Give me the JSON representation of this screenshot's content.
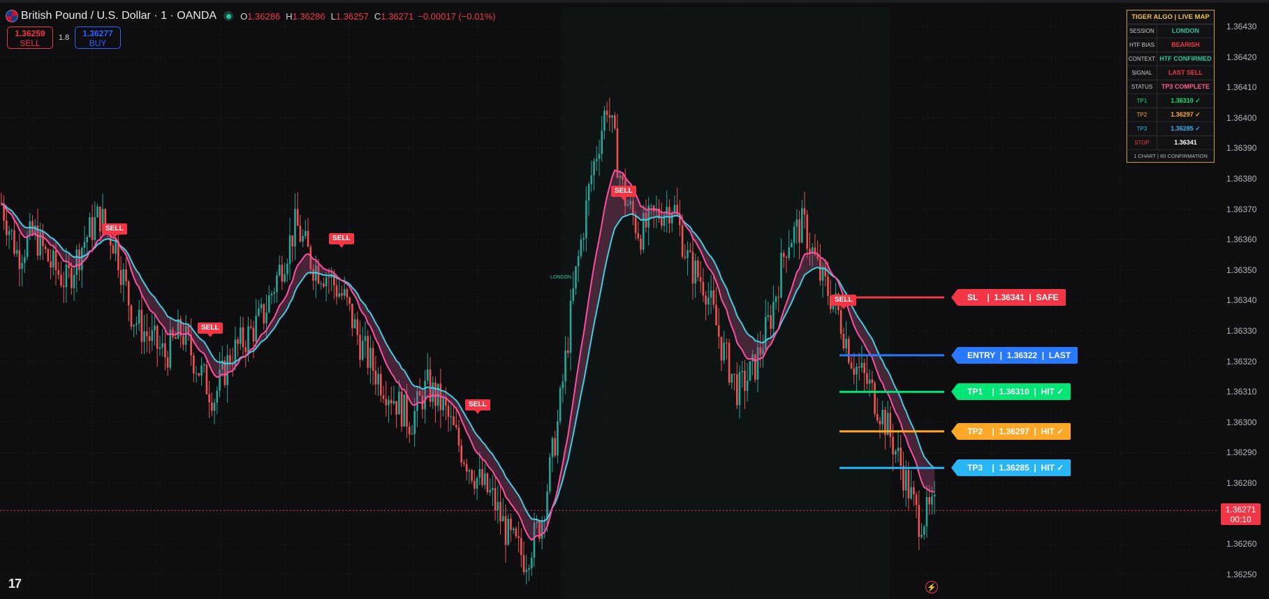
{
  "header": {
    "title": "British Pound / U.S. Dollar · 1 · OANDA",
    "o_label": "O",
    "o_value": "1.36286",
    "h_label": "H",
    "h_value": "1.36286",
    "l_label": "L",
    "l_value": "1.36257",
    "c_label": "C",
    "c_value": "1.36271",
    "change": "−0.00017 (−0.01%)"
  },
  "trade": {
    "sell_price": "1.36259",
    "sell_label": "SELL",
    "spread": "1.8",
    "buy_price": "1.36277",
    "buy_label": "BUY"
  },
  "y_axis": [
    "1.36430",
    "1.36420",
    "1.36410",
    "1.36400",
    "1.36390",
    "1.36380",
    "1.36370",
    "1.36360",
    "1.36350",
    "1.36340",
    "1.36330",
    "1.36320",
    "1.36310",
    "1.36300",
    "1.36290",
    "1.36280",
    "1.36270",
    "1.36260",
    "1.36250"
  ],
  "current_price": {
    "price": "1.36271",
    "countdown": "00:10",
    "value": 1.36271
  },
  "infobox": {
    "title": "TIGER ALGO | LIVE MAP",
    "rows": [
      {
        "k": "SESSION",
        "v": "LONDON",
        "color": "#26c6a0"
      },
      {
        "k": "HTF BIAS",
        "v": "BEARISH",
        "color": "#f23645"
      },
      {
        "k": "CONTEXT",
        "v": "HTF CONFIRMED",
        "color": "#26c6a0"
      },
      {
        "k": "SIGNAL",
        "v": "LAST SELL",
        "color": "#f23645"
      },
      {
        "k": "STATUS",
        "v": "TP3 COMPLETE",
        "color": "#ff5e8a"
      },
      {
        "k": "TP1",
        "v": "1.36310  ✓",
        "color": "#00e676"
      },
      {
        "k": "TP2",
        "v": "1.36297  ✓",
        "color": "#ffa726"
      },
      {
        "k": "TP3",
        "v": "1.36285  ✓",
        "color": "#29b6f6"
      },
      {
        "k": "STOP",
        "v": "1.36341",
        "color": "#ffffff"
      }
    ],
    "footer": "1 CHART | 60 CONFIRMATION"
  },
  "levels": [
    {
      "name": "SL",
      "text": "SL    |  1.36341  |  SAFE",
      "value": 1.36341,
      "color": "#f23645"
    },
    {
      "name": "ENTRY",
      "text": "ENTRY  |  1.36322  |  LAST",
      "value": 1.36322,
      "color": "#2979ff"
    },
    {
      "name": "TP1",
      "text": "TP1    |  1.36310  |  HIT ✓",
      "value": 1.3631,
      "color": "#00e676"
    },
    {
      "name": "TP2",
      "text": "TP2    |  1.36297  |  HIT ✓",
      "value": 1.36297,
      "color": "#ffa726"
    },
    {
      "name": "TP3",
      "text": "TP3    |  1.36285  |  HIT ✓",
      "value": 1.36285,
      "color": "#29b6f6"
    }
  ],
  "signals": [
    "SELL",
    "SELL",
    "SELL",
    "SELL",
    "SELL",
    "SELL"
  ],
  "session_label": "LONDON",
  "colors": {
    "up": "#26a69a",
    "down": "#ef5350",
    "fast": "#ff4fa3",
    "slow": "#3fd0e6"
  },
  "chart_data": {
    "type": "candlestick",
    "symbol": "GBPUSD",
    "ylim": [
      1.3625,
      1.36435
    ],
    "path_points": [
      1.36372,
      1.36355,
      1.36362,
      1.36352,
      1.36346,
      1.36359,
      1.36368,
      1.36358,
      1.36335,
      1.36328,
      1.36322,
      1.3633,
      1.36318,
      1.36308,
      1.36322,
      1.36328,
      1.36335,
      1.3635,
      1.36365,
      1.36352,
      1.36348,
      1.3634,
      1.36325,
      1.36315,
      1.36308,
      1.363,
      1.36312,
      1.36305,
      1.36292,
      1.36282,
      1.36275,
      1.36262,
      1.36255,
      1.36268,
      1.363,
      1.36345,
      1.3638,
      1.36405,
      1.36375,
      1.36362,
      1.36368,
      1.36372,
      1.36352,
      1.36345,
      1.36325,
      1.3631,
      1.36318,
      1.36335,
      1.3636,
      1.36365,
      1.36348,
      1.36338,
      1.3632,
      1.36312,
      1.363,
      1.36285,
      1.36268,
      1.36271
    ]
  }
}
